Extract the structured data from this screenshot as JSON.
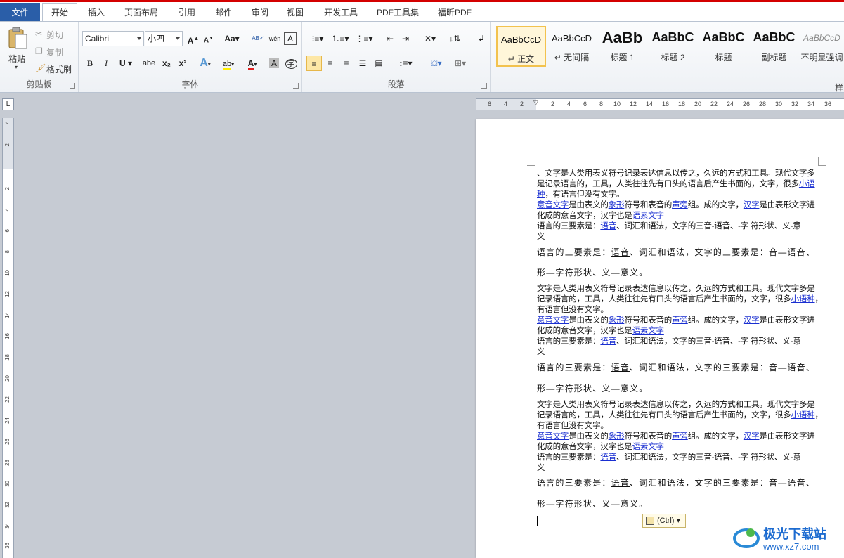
{
  "tabs": {
    "file": "文件",
    "home": "开始",
    "insert": "插入",
    "layout": "页面布局",
    "references": "引用",
    "mailings": "邮件",
    "review": "审阅",
    "view": "视图",
    "developer": "开发工具",
    "pdf_tools": "PDF工具集",
    "foxit": "福昕PDF"
  },
  "clipboard": {
    "paste": "粘贴",
    "cut": "剪切",
    "copy": "复制",
    "format_painter": "格式刷",
    "group_label": "剪贴板"
  },
  "font": {
    "name": "Calibri",
    "size": "小四",
    "group_label": "字体",
    "bold": "B",
    "italic": "I",
    "underline": "U",
    "strike": "abe",
    "subscript": "x₂",
    "superscript": "x²",
    "grow": "A",
    "shrink": "A",
    "change_case": "Aa",
    "phonetic": "wén",
    "char_border": "A",
    "effects": "A",
    "highlight": "ab",
    "color": "A",
    "shading": "A",
    "enclose": "字"
  },
  "paragraph": {
    "group_label": "段落"
  },
  "styles": {
    "group_label": "样",
    "items": [
      {
        "preview": "AaBbCcD",
        "name": "↵ 正文"
      },
      {
        "preview": "AaBbCcD",
        "name": "↵ 无间隔"
      },
      {
        "preview": "AaBb",
        "name": "标题 1"
      },
      {
        "preview": "AaBbC",
        "name": "标题 2"
      },
      {
        "preview": "AaBbC",
        "name": "标题"
      },
      {
        "preview": "AaBbC",
        "name": "副标题"
      },
      {
        "preview": "AaBbCcD",
        "name": "不明显强调"
      }
    ]
  },
  "ruler": {
    "corner": "L",
    "h_numbers": [
      "6",
      "4",
      "2",
      "2",
      "4",
      "6",
      "8",
      "10",
      "12",
      "14",
      "16",
      "18",
      "20",
      "22",
      "24",
      "26",
      "28",
      "30",
      "32",
      "34",
      "36"
    ],
    "v_numbers": [
      "4",
      "2",
      "2",
      "4",
      "6",
      "8",
      "10",
      "12",
      "14",
      "16",
      "18",
      "20",
      "22",
      "24",
      "26",
      "28",
      "30",
      "32",
      "34",
      "36"
    ]
  },
  "document": {
    "b1": {
      "l1": "、文字是人类用表义符号记录表达信息以传之，久远的方式和工具。现代文字多",
      "l2a": "是记录语言的，工具，人类往往先有口头的语言后产生书面的，文字，很多",
      "l2b": "小语",
      "l3a": "种",
      "l3b": "，有语言但没有文字。",
      "l4a": "意音文字",
      "l4b": "是由表义的",
      "l4c": "象形",
      "l4d": "符号和表音的",
      "l4e": "声旁",
      "l4f": "组。成的文字，",
      "l4g": "汉字",
      "l4h": "是由表形文字进",
      "l5a": "化成的意音文字，汉字也是",
      "l5b": "语素文字",
      "l6a": "语言的三要素是：",
      "l6b": "语音",
      "l6c": "、词汇和语法，文字的三音-语音、-字 符形状、义-意",
      "l7": "义",
      "l8a": "语言的三要素是：",
      "l8b": "语音",
      "l8c": "、词汇和语法，文字的三要素是：音—语音、",
      "l9": "形—字符形状、义—意义。"
    },
    "b2": {
      "l1": "文字是人类用表义符号记录表达信息以传之，久远的方式和工具。现代文字多是",
      "l2a": "记录语言的，工具，人类往往先有口头的语言后产生书面的，文字，很多",
      "l2b": "小语种",
      "l2c": "，",
      "l3": "有语言但没有文字。",
      "l4a": "意音文字",
      "l4b": "是由表义的",
      "l4c": "象形",
      "l4d": "符号和表音的",
      "l4e": "声旁",
      "l4f": "组。成的文字，",
      "l4g": "汉字",
      "l4h": "是由表形文字进",
      "l5a": "化成的意音文字，汉字也是",
      "l5b": "语素文字",
      "l6a": "语言的三要素是：",
      "l6b": "语音",
      "l6c": "、词汇和语法，文字的三音-语音、-字 符形状、义-意",
      "l7": "义",
      "l8a": "语言的三要素是：",
      "l8b": "语音",
      "l8c": "、词汇和语法，文字的三要素是：音—语音、",
      "l9": "形—字符形状、义—意义。"
    },
    "paste_options": "(Ctrl)"
  },
  "watermark": {
    "title": "极光下载站",
    "url": "www.xz7.com"
  }
}
